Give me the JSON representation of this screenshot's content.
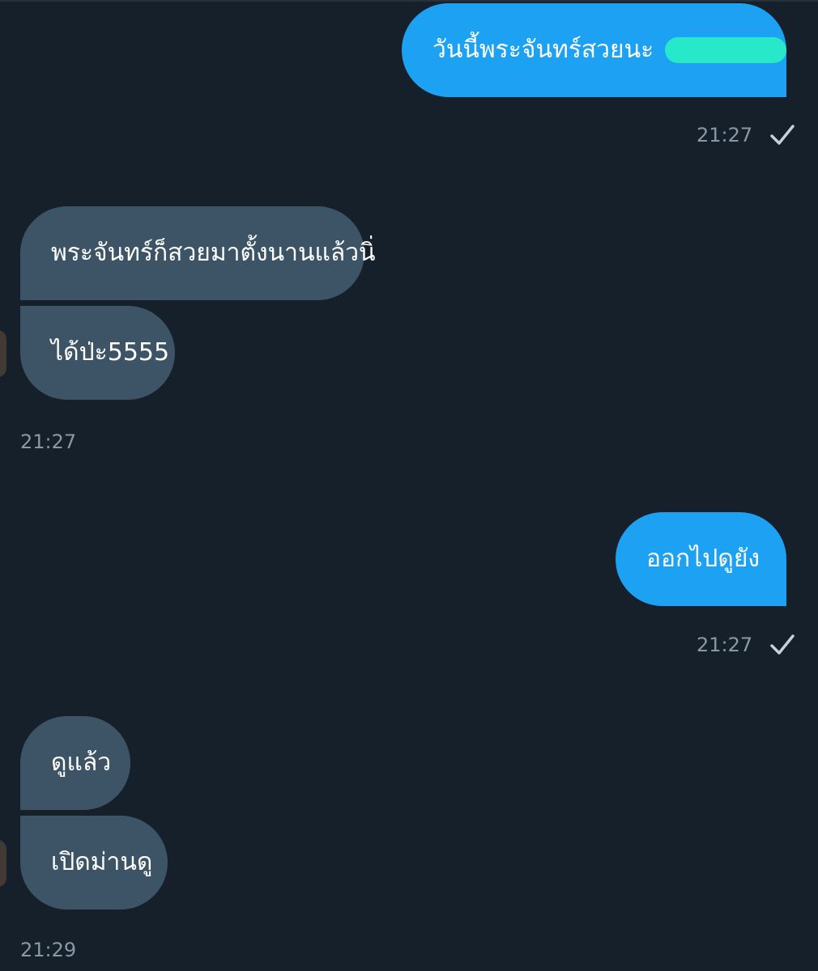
{
  "colors": {
    "background": "#16202a",
    "outgoing_bubble": "#1da1f2",
    "incoming_bubble": "#3d5466",
    "meta_text": "#8899a6",
    "redaction": "#27e8c9"
  },
  "messages": [
    {
      "direction": "outgoing",
      "text": "วันนี้พระจันทร์สวยนะ",
      "redacted_suffix": true,
      "time": "21:27",
      "status_icon": "check-icon"
    },
    {
      "direction": "incoming",
      "text": "พระจันทร์ก็สวยมาตั้งนานแล้วนิ่"
    },
    {
      "direction": "incoming",
      "text": "ได้ป่ะ5555",
      "time": "21:27"
    },
    {
      "direction": "outgoing",
      "text": "ออกไปดูยัง",
      "time": "21:27",
      "status_icon": "check-icon"
    },
    {
      "direction": "incoming",
      "text": "ดูแล้ว"
    },
    {
      "direction": "incoming",
      "text": "เปิดม่านดู",
      "time": "21:29"
    }
  ]
}
